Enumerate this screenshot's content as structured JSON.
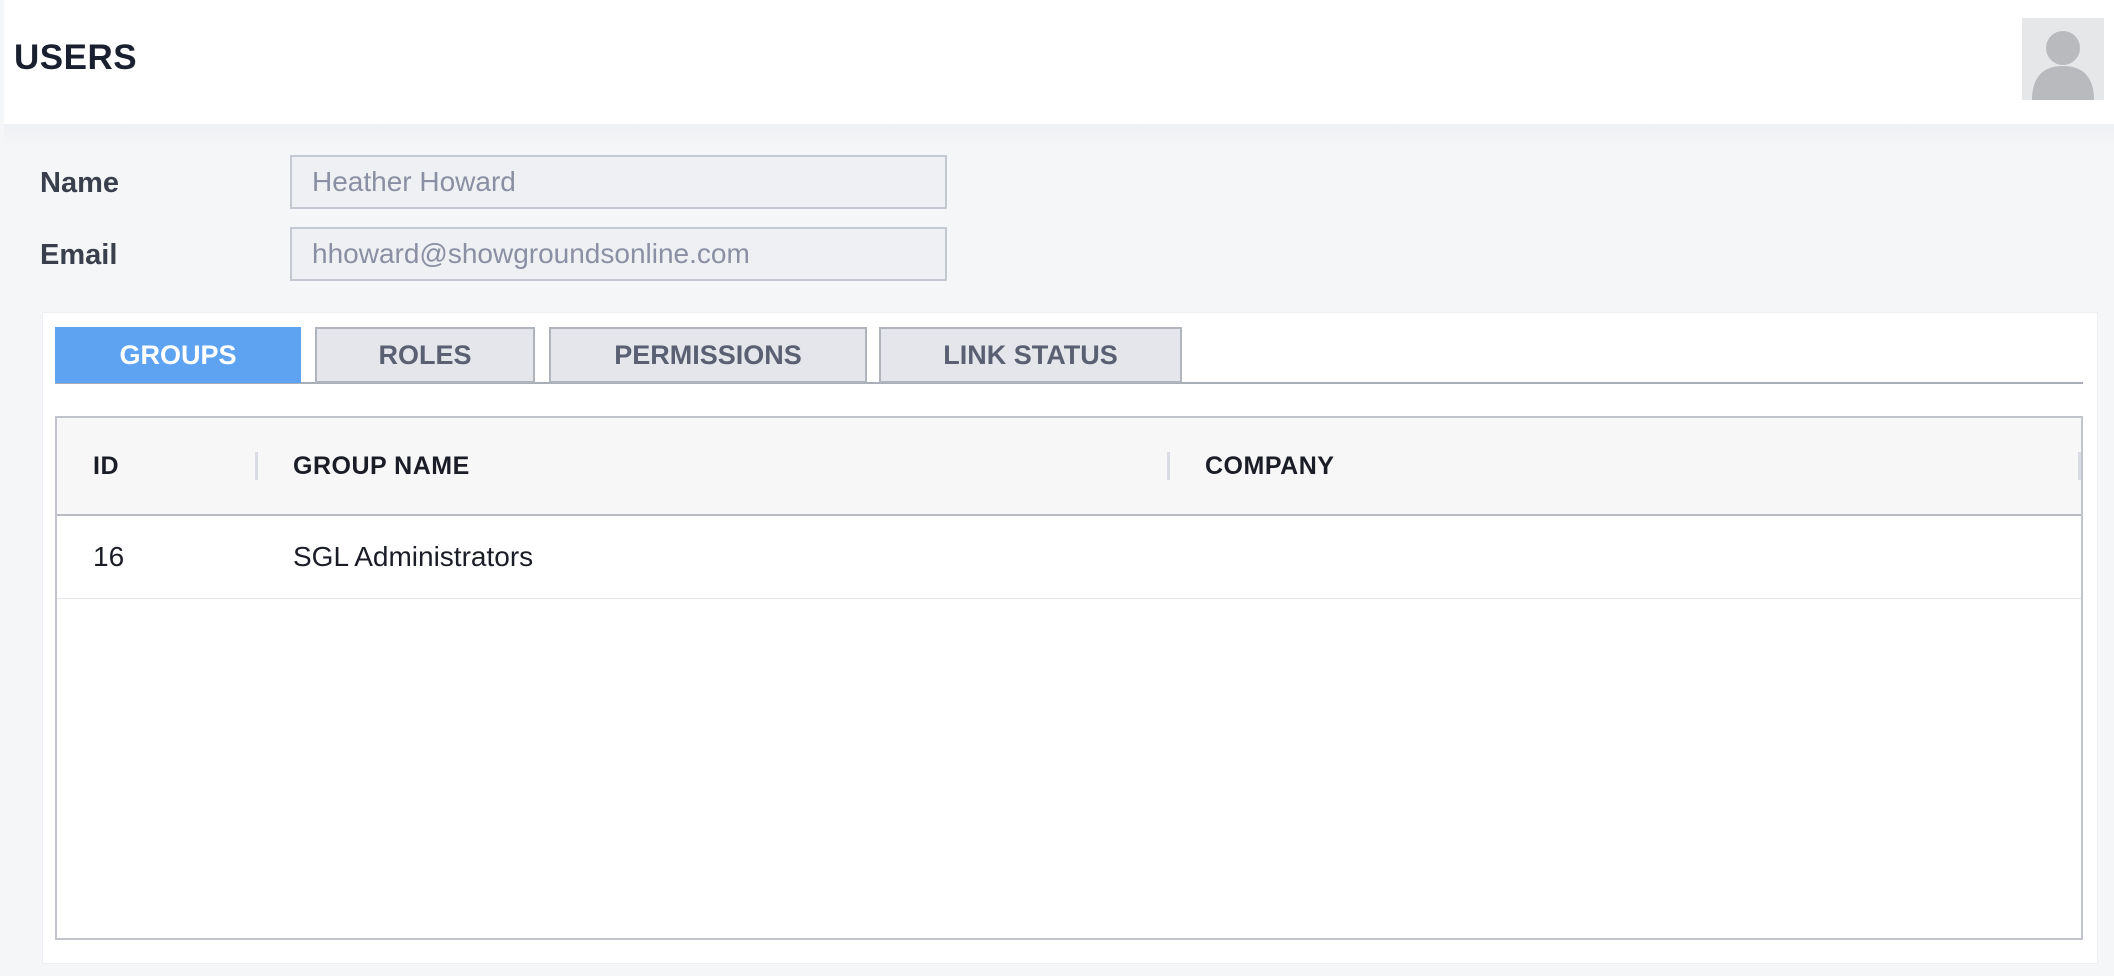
{
  "header": {
    "title": "USERS",
    "avatar_icon": "user-avatar-icon"
  },
  "form": {
    "name_label": "Name",
    "name_value": "Heather Howard",
    "email_label": "Email",
    "email_value": "hhoward@showgroundsonline.com"
  },
  "tabs": [
    {
      "label": "GROUPS",
      "active": true
    },
    {
      "label": "ROLES",
      "active": false
    },
    {
      "label": "PERMISSIONS",
      "active": false
    },
    {
      "label": "LINK STATUS",
      "active": false
    }
  ],
  "table": {
    "columns": [
      "ID",
      "GROUP NAME",
      "COMPANY"
    ],
    "rows": [
      {
        "id": "16",
        "group_name": "SGL Administrators",
        "company": ""
      }
    ]
  },
  "colors": {
    "accent": "#5ea2f2",
    "tab_inactive_bg": "#e4e6ec",
    "input_bg": "#eef0f4"
  }
}
